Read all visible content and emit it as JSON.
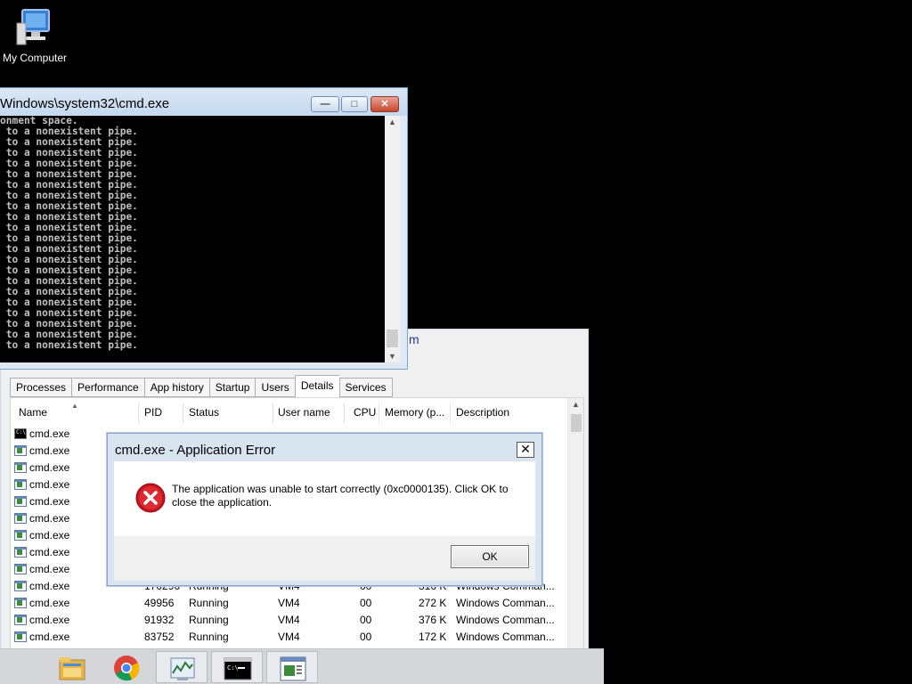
{
  "desktop": {
    "icons": [
      {
        "label": "My Computer",
        "icon": "computer-icon"
      }
    ]
  },
  "cmd": {
    "title": "Windows\\system32\\cmd.exe",
    "lines": [
      "onment space.",
      " to a nonexistent pipe.",
      " to a nonexistent pipe.",
      " to a nonexistent pipe.",
      " to a nonexistent pipe.",
      " to a nonexistent pipe.",
      " to a nonexistent pipe.",
      " to a nonexistent pipe.",
      " to a nonexistent pipe.",
      " to a nonexistent pipe.",
      " to a nonexistent pipe.",
      " to a nonexistent pipe.",
      " to a nonexistent pipe.",
      " to a nonexistent pipe.",
      " to a nonexistent pipe.",
      " to a nonexistent pipe.",
      " to a nonexistent pipe.",
      " to a nonexistent pipe.",
      " to a nonexistent pipe.",
      " to a nonexistent pipe.",
      " to a nonexistent pipe.",
      " to a nonexistent pipe."
    ],
    "buttons": {
      "minimize": "—",
      "maximize": "□",
      "close": "✕"
    }
  },
  "taskmgr": {
    "title_fragment": "m",
    "tabs": [
      "Processes",
      "Performance",
      "App history",
      "Startup",
      "Users",
      "Details",
      "Services"
    ],
    "active_tab": "Details",
    "columns": [
      "Name",
      "PID",
      "Status",
      "User name",
      "CPU",
      "Memory (p...",
      "Description"
    ],
    "rows": [
      {
        "name": "cmd.exe",
        "pid": "",
        "status": "",
        "user": "",
        "cpu": "",
        "mem": "",
        "desc": "",
        "icon": "cmd-icon"
      },
      {
        "name": "cmd.exe",
        "pid": "",
        "status": "",
        "user": "",
        "cpu": "",
        "mem": "",
        "desc": "",
        "icon": "console-app-icon"
      },
      {
        "name": "cmd.exe",
        "pid": "",
        "status": "",
        "user": "",
        "cpu": "",
        "mem": "",
        "desc": "",
        "icon": "console-app-icon"
      },
      {
        "name": "cmd.exe",
        "pid": "",
        "status": "",
        "user": "",
        "cpu": "",
        "mem": "",
        "desc": "",
        "icon": "console-app-icon"
      },
      {
        "name": "cmd.exe",
        "pid": "",
        "status": "",
        "user": "",
        "cpu": "",
        "mem": "",
        "desc": "",
        "icon": "console-app-icon"
      },
      {
        "name": "cmd.exe",
        "pid": "",
        "status": "",
        "user": "",
        "cpu": "",
        "mem": "",
        "desc": "",
        "icon": "console-app-icon"
      },
      {
        "name": "cmd.exe",
        "pid": "",
        "status": "",
        "user": "",
        "cpu": "",
        "mem": "",
        "desc": "",
        "icon": "console-app-icon"
      },
      {
        "name": "cmd.exe",
        "pid": "",
        "status": "",
        "user": "",
        "cpu": "",
        "mem": "",
        "desc": "",
        "icon": "console-app-icon"
      },
      {
        "name": "cmd.exe",
        "pid": "",
        "status": "",
        "user": "",
        "cpu": "",
        "mem": "",
        "desc": "",
        "icon": "console-app-icon"
      },
      {
        "name": "cmd.exe",
        "pid": "170296",
        "status": "Running",
        "user": "VM4",
        "cpu": "00",
        "mem": "316 K",
        "desc": "Windows Comman...",
        "icon": "console-app-icon"
      },
      {
        "name": "cmd.exe",
        "pid": "49956",
        "status": "Running",
        "user": "VM4",
        "cpu": "00",
        "mem": "272 K",
        "desc": "Windows Comman...",
        "icon": "console-app-icon"
      },
      {
        "name": "cmd.exe",
        "pid": "91932",
        "status": "Running",
        "user": "VM4",
        "cpu": "00",
        "mem": "376 K",
        "desc": "Windows Comman...",
        "icon": "console-app-icon"
      },
      {
        "name": "cmd.exe",
        "pid": "83752",
        "status": "Running",
        "user": "VM4",
        "cpu": "00",
        "mem": "172 K",
        "desc": "Windows Comman...",
        "icon": "console-app-icon"
      }
    ]
  },
  "dialog": {
    "title": "cmd.exe - Application Error",
    "message": "The application was unable to start correctly (0xc0000135). Click OK to close the application.",
    "ok_label": "OK",
    "close_glyph": "✕",
    "icon": "error-icon"
  },
  "taskbar": {
    "items": [
      {
        "icon": "file-explorer-icon",
        "running": false
      },
      {
        "icon": "chrome-icon",
        "running": false
      },
      {
        "icon": "task-manager-icon",
        "running": true
      },
      {
        "icon": "command-prompt-icon",
        "running": true
      },
      {
        "icon": "console-window-icon",
        "running": true
      }
    ]
  },
  "colors": {
    "desktop": "#000000",
    "console_bg": "#000000",
    "console_text": "#c0c0c0",
    "error_red": "#d0202a",
    "window_frame": "#dfe9f5"
  }
}
